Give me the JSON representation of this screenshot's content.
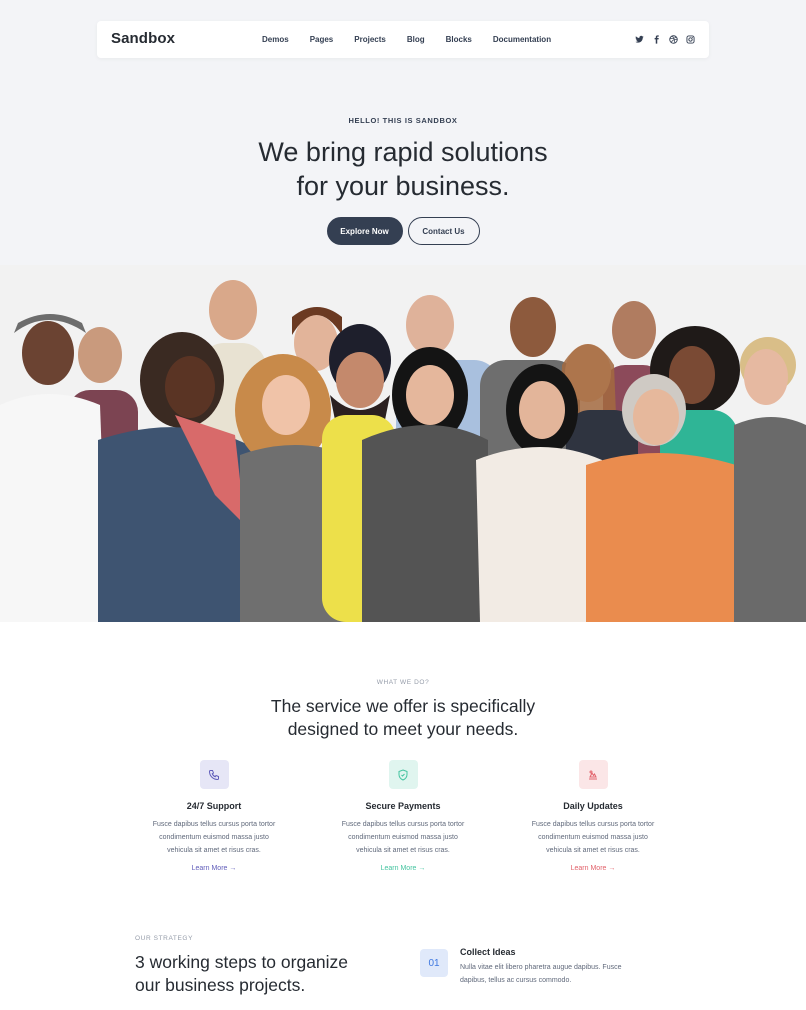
{
  "navbar": {
    "logo": "Sandbox",
    "links": [
      "Demos",
      "Pages",
      "Projects",
      "Blog",
      "Blocks",
      "Documentation"
    ],
    "socials": [
      "twitter-icon",
      "facebook-icon",
      "dribbble-icon",
      "instagram-icon"
    ]
  },
  "hero": {
    "eyebrow": "HELLO! THIS IS SANDBOX",
    "title_line1": "We bring rapid solutions",
    "title_line2": "for your business.",
    "primary_button": "Explore Now",
    "secondary_button": "Contact Us"
  },
  "services": {
    "eyebrow": "WHAT WE DO?",
    "title_line1": "The service we offer is specifically",
    "title_line2": "designed to meet your needs.",
    "items": [
      {
        "icon": "phone-icon",
        "title": "24/7 Support",
        "text_line1": "Fusce dapibus tellus cursus porta tortor",
        "text_line2": "condimentum euismod massa justo",
        "text_line3": "vehicula sit amet et risus cras.",
        "link": "Learn More →",
        "color": "#605dba",
        "icon_bg": "#e6e6f6"
      },
      {
        "icon": "shield-icon",
        "title": "Secure Payments",
        "text_line1": "Fusce dapibus tellus cursus porta tortor",
        "text_line2": "condimentum euismod massa justo",
        "text_line3": "vehicula sit amet et risus cras.",
        "link": "Learn More →",
        "color": "#45c4a0",
        "icon_bg": "#e0f5ef"
      },
      {
        "icon": "update-icon",
        "title": "Daily Updates",
        "text_line1": "Fusce dapibus tellus cursus porta tortor",
        "text_line2": "condimentum euismod massa justo",
        "text_line3": "vehicula sit amet et risus cras.",
        "link": "Learn More →",
        "color": "#e2626b",
        "icon_bg": "#fbe6e7"
      }
    ]
  },
  "strategy": {
    "eyebrow": "OUR STRATEGY",
    "title_line1": "3 working steps to organize",
    "title_line2": "our business projects.",
    "step": {
      "number": "01",
      "title": "Collect Ideas",
      "text_line1": "Nulla vitae elit libero pharetra augue dapibus. Fusce",
      "text_line2": "dapibus, tellus ac cursus commodo."
    }
  }
}
